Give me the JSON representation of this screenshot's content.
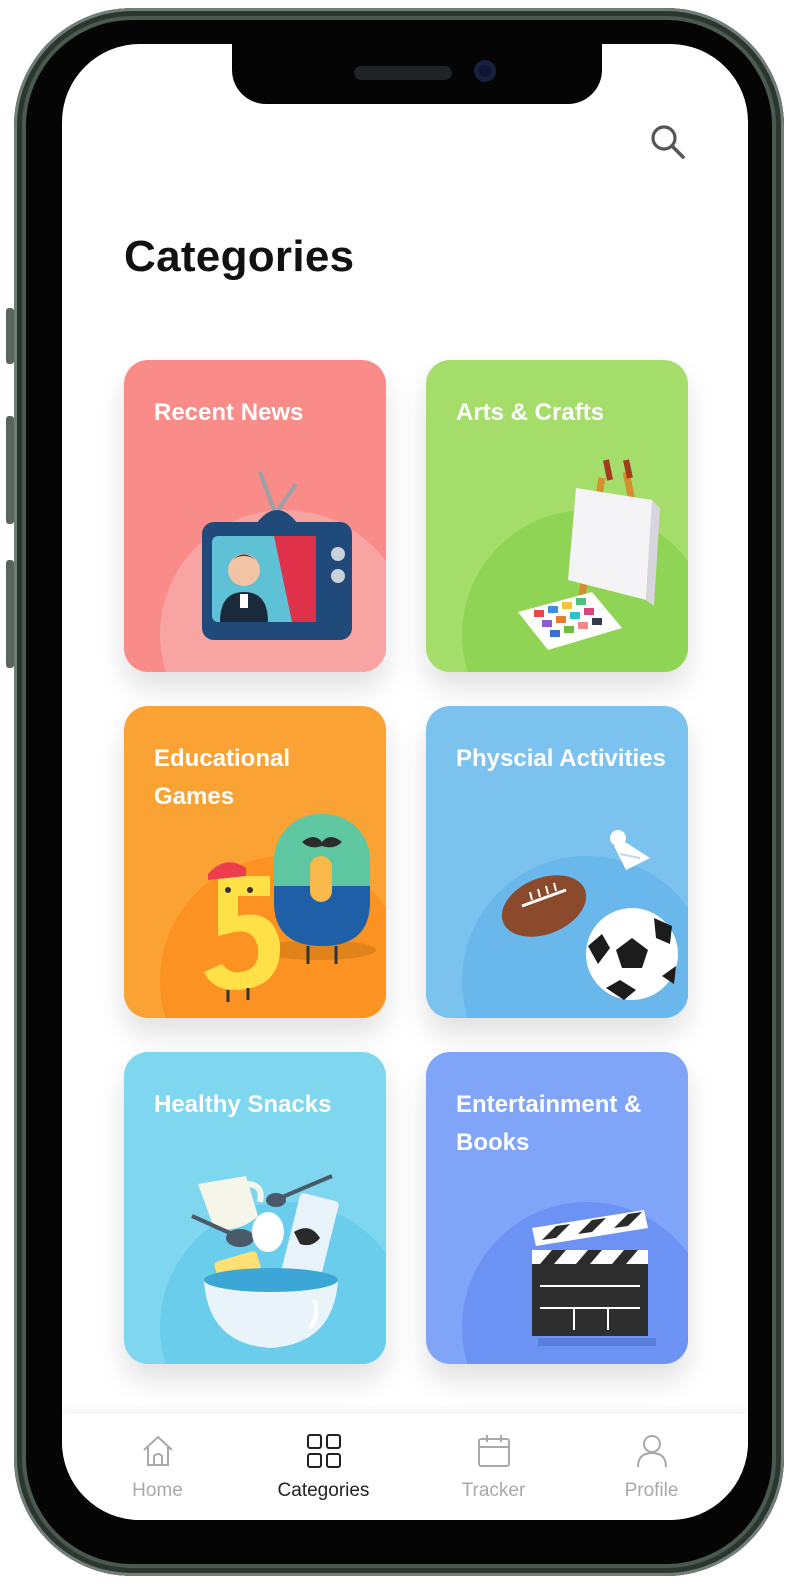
{
  "header": {
    "title": "Categories",
    "search_icon": "search-icon"
  },
  "categories": [
    {
      "label": "Recent News",
      "color": "#f98b89",
      "icon": "news-tv-icon"
    },
    {
      "label": "Arts & Crafts",
      "color": "#a5dd6a",
      "icon": "easel-paint-icon"
    },
    {
      "label": "Educational Games",
      "color": "#fba234",
      "icon": "number-characters-icon"
    },
    {
      "label": "Physcial Activities",
      "color": "#7cc2ee",
      "icon": "sports-balls-icon"
    },
    {
      "label": "Healthy Snacks",
      "color": "#7ed6ef",
      "icon": "cooking-bowl-icon"
    },
    {
      "label": "Entertainment & Books",
      "color": "#7fa4f8",
      "icon": "clapperboard-icon"
    }
  ],
  "tabbar": {
    "items": [
      {
        "label": "Home",
        "icon": "home-icon",
        "active": false
      },
      {
        "label": "Categories",
        "icon": "grid-icon",
        "active": true
      },
      {
        "label": "Tracker",
        "icon": "calendar-icon",
        "active": false
      },
      {
        "label": "Profile",
        "icon": "profile-icon",
        "active": false
      }
    ]
  }
}
